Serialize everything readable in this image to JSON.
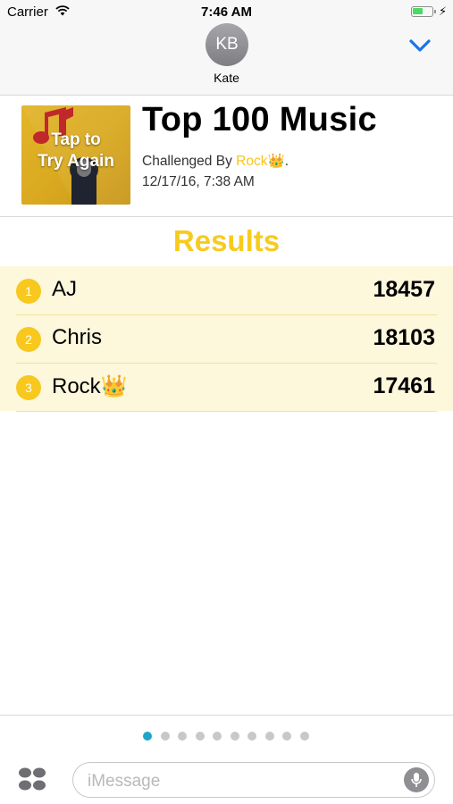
{
  "status_bar": {
    "carrier": "Carrier",
    "time": "7:46 AM"
  },
  "header": {
    "avatar_initials": "KB",
    "contact_name": "Kate"
  },
  "game": {
    "thumbnail_text_line1": "Tap to",
    "thumbnail_text_line2": "Try Again",
    "title": "Top 100 Music",
    "challenged_prefix": "Challenged By ",
    "challenger": "Rock👑",
    "challenged_suffix": ".",
    "date": "12/17/16, 7:38 AM"
  },
  "results": {
    "title": "Results",
    "rows": [
      {
        "rank": "1",
        "name": "AJ",
        "score": "18457"
      },
      {
        "rank": "2",
        "name": "Chris",
        "score": "18103"
      },
      {
        "rank": "3",
        "name": "Rock👑",
        "score": "17461"
      }
    ]
  },
  "pager": {
    "page_count": 10,
    "active_index": 0
  },
  "composer": {
    "placeholder": "iMessage"
  },
  "colors": {
    "accent_yellow": "#f7ca1e",
    "chevron_blue": "#1a73e8",
    "active_dot": "#1ea5c9",
    "battery_green": "#4cd964"
  },
  "icons": [
    "wifi-icon",
    "battery-icon",
    "charging-bolt-icon",
    "chevron-down-icon",
    "music-note-icon",
    "microphone-icon",
    "app-drawer-icon"
  ]
}
